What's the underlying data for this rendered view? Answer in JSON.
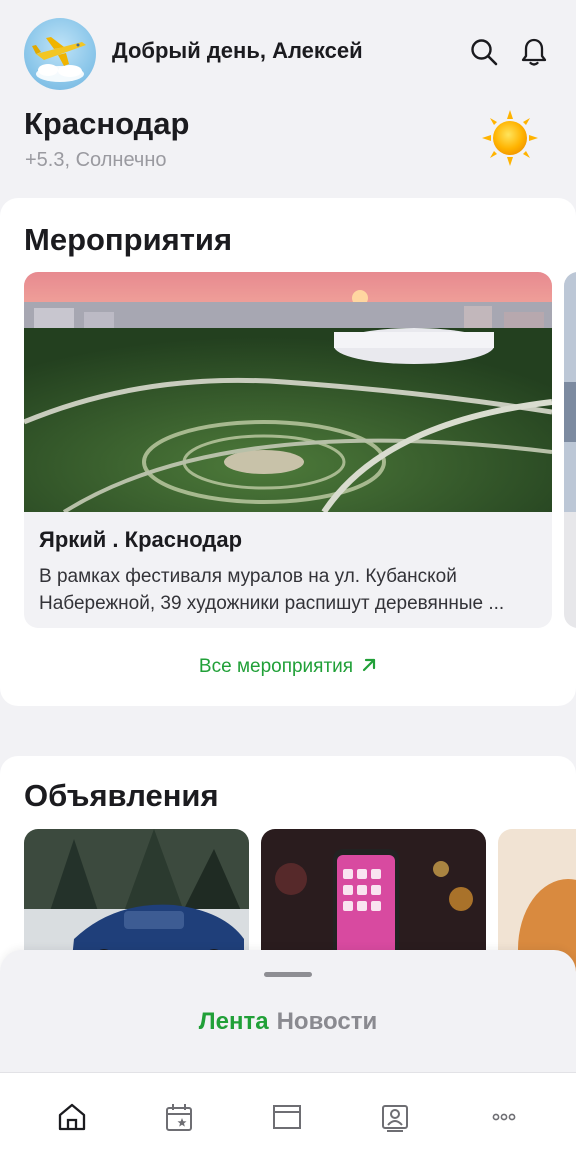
{
  "header": {
    "greeting": "Добрый день, Алексей",
    "avatar_icon": "airplane-icon",
    "search_icon": "search-icon",
    "notifications_icon": "bell-icon"
  },
  "location": {
    "city": "Краснодар",
    "weather": "+5.3, Солнечно",
    "weather_icon": "sun-icon"
  },
  "events": {
    "title": "Мероприятия",
    "items": [
      {
        "title": "Яркий . Краснодар",
        "description_line1": "В рамках фестиваля муралов на ул. Кубанской",
        "description_line2": "Набережной, 39 художники распишут деревянные ..."
      }
    ],
    "all_link": "Все мероприятия",
    "link_icon": "arrow-up-right-icon"
  },
  "ads": {
    "title": "Объявления",
    "items": [
      "car-photo",
      "smartphone-photo",
      "pet-photo"
    ]
  },
  "sheet": {
    "tabs": [
      {
        "label": "Лента",
        "active": true
      },
      {
        "label": "Новости",
        "active": false
      }
    ]
  },
  "navbar": {
    "items": [
      "home-icon",
      "calendar-icon",
      "listings-icon",
      "profile-card-icon",
      "more-icon"
    ],
    "active": "home-icon"
  },
  "colors": {
    "accent": "#21a038",
    "background": "#f2f2f5",
    "card": "#ffffff",
    "muted_text": "#9a9aa0"
  }
}
